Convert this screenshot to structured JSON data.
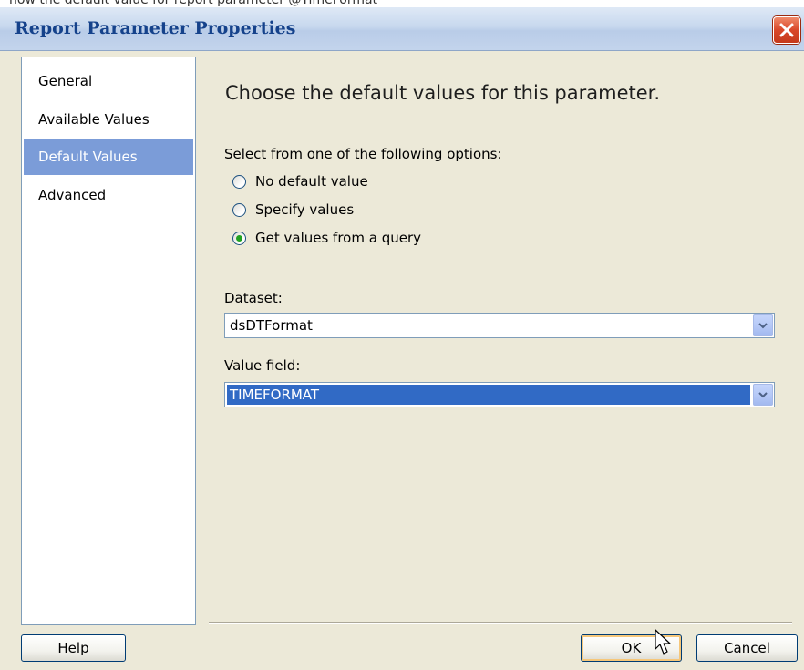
{
  "background_text": "how the default value for report parameter @TimeFormat",
  "window": {
    "title": "Report Parameter Properties",
    "close_icon": "close-icon"
  },
  "sidebar": {
    "items": [
      {
        "label": "General",
        "selected": false
      },
      {
        "label": "Available Values",
        "selected": false
      },
      {
        "label": "Default Values",
        "selected": true
      },
      {
        "label": "Advanced",
        "selected": false
      }
    ]
  },
  "main": {
    "heading": "Choose the default values for this parameter.",
    "options_label": "Select from one of the following options:",
    "options": [
      {
        "label": "No default value",
        "checked": false
      },
      {
        "label": "Specify values",
        "checked": false
      },
      {
        "label": "Get values from a query",
        "checked": true
      }
    ],
    "dataset": {
      "label": "Dataset:",
      "value": "dsDTFormat"
    },
    "value_field": {
      "label": "Value field:",
      "value": "TIMEFORMAT"
    }
  },
  "buttons": {
    "help": "Help",
    "ok": "OK",
    "cancel": "Cancel"
  },
  "colors": {
    "title_text": "#15428b",
    "selected_nav": "#7b9cd8",
    "selection": "#316ac5",
    "radio_dot": "#21a121"
  }
}
